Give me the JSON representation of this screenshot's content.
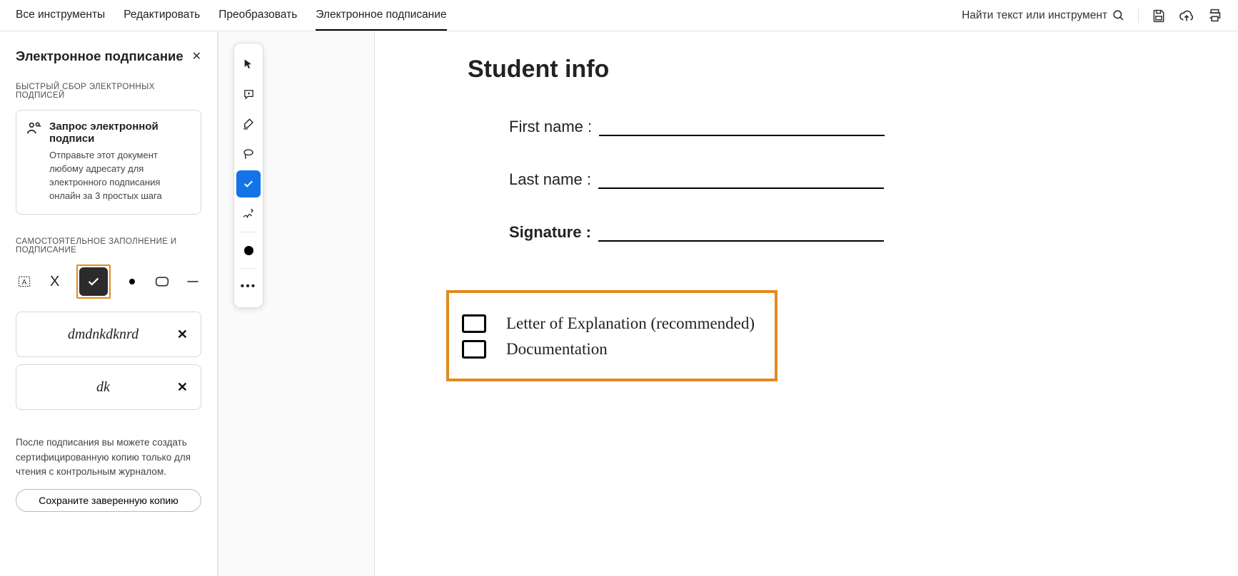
{
  "topbar": {
    "tabs": {
      "all_tools": "Все инструменты",
      "edit": "Редактировать",
      "convert": "Преобразовать",
      "esign": "Электронное подписание"
    },
    "search_placeholder": "Найти текст или инструмент"
  },
  "sidebar": {
    "title": "Электронное подписание",
    "section_collect": "БЫСТРЫЙ СБОР ЭЛЕКТРОННЫХ ПОДПИСЕЙ",
    "request_card": {
      "title": "Запрос электронной подписи",
      "desc": "Отправьте этот документ любому адресату для электронного подписания онлайн за 3 простых шага"
    },
    "section_self": "САМОСТОЯТЕЛЬНОЕ ЗАПОЛНЕНИЕ И ПОДПИСАНИЕ",
    "signatures": {
      "sig1": "dmdnkdknrd",
      "sig2": "dk"
    },
    "note": "После подписания вы можете создать сертифицированную копию только для чтения с контрольным журналом.",
    "save_btn": "Сохраните заверенную копию"
  },
  "document": {
    "title": "Student info",
    "fields": {
      "first_name": "First name :",
      "last_name": "Last name :",
      "signature": "Signature :"
    },
    "checkboxes": {
      "letter": "Letter of Explanation (recommended)",
      "documentation": "Documentation"
    }
  }
}
